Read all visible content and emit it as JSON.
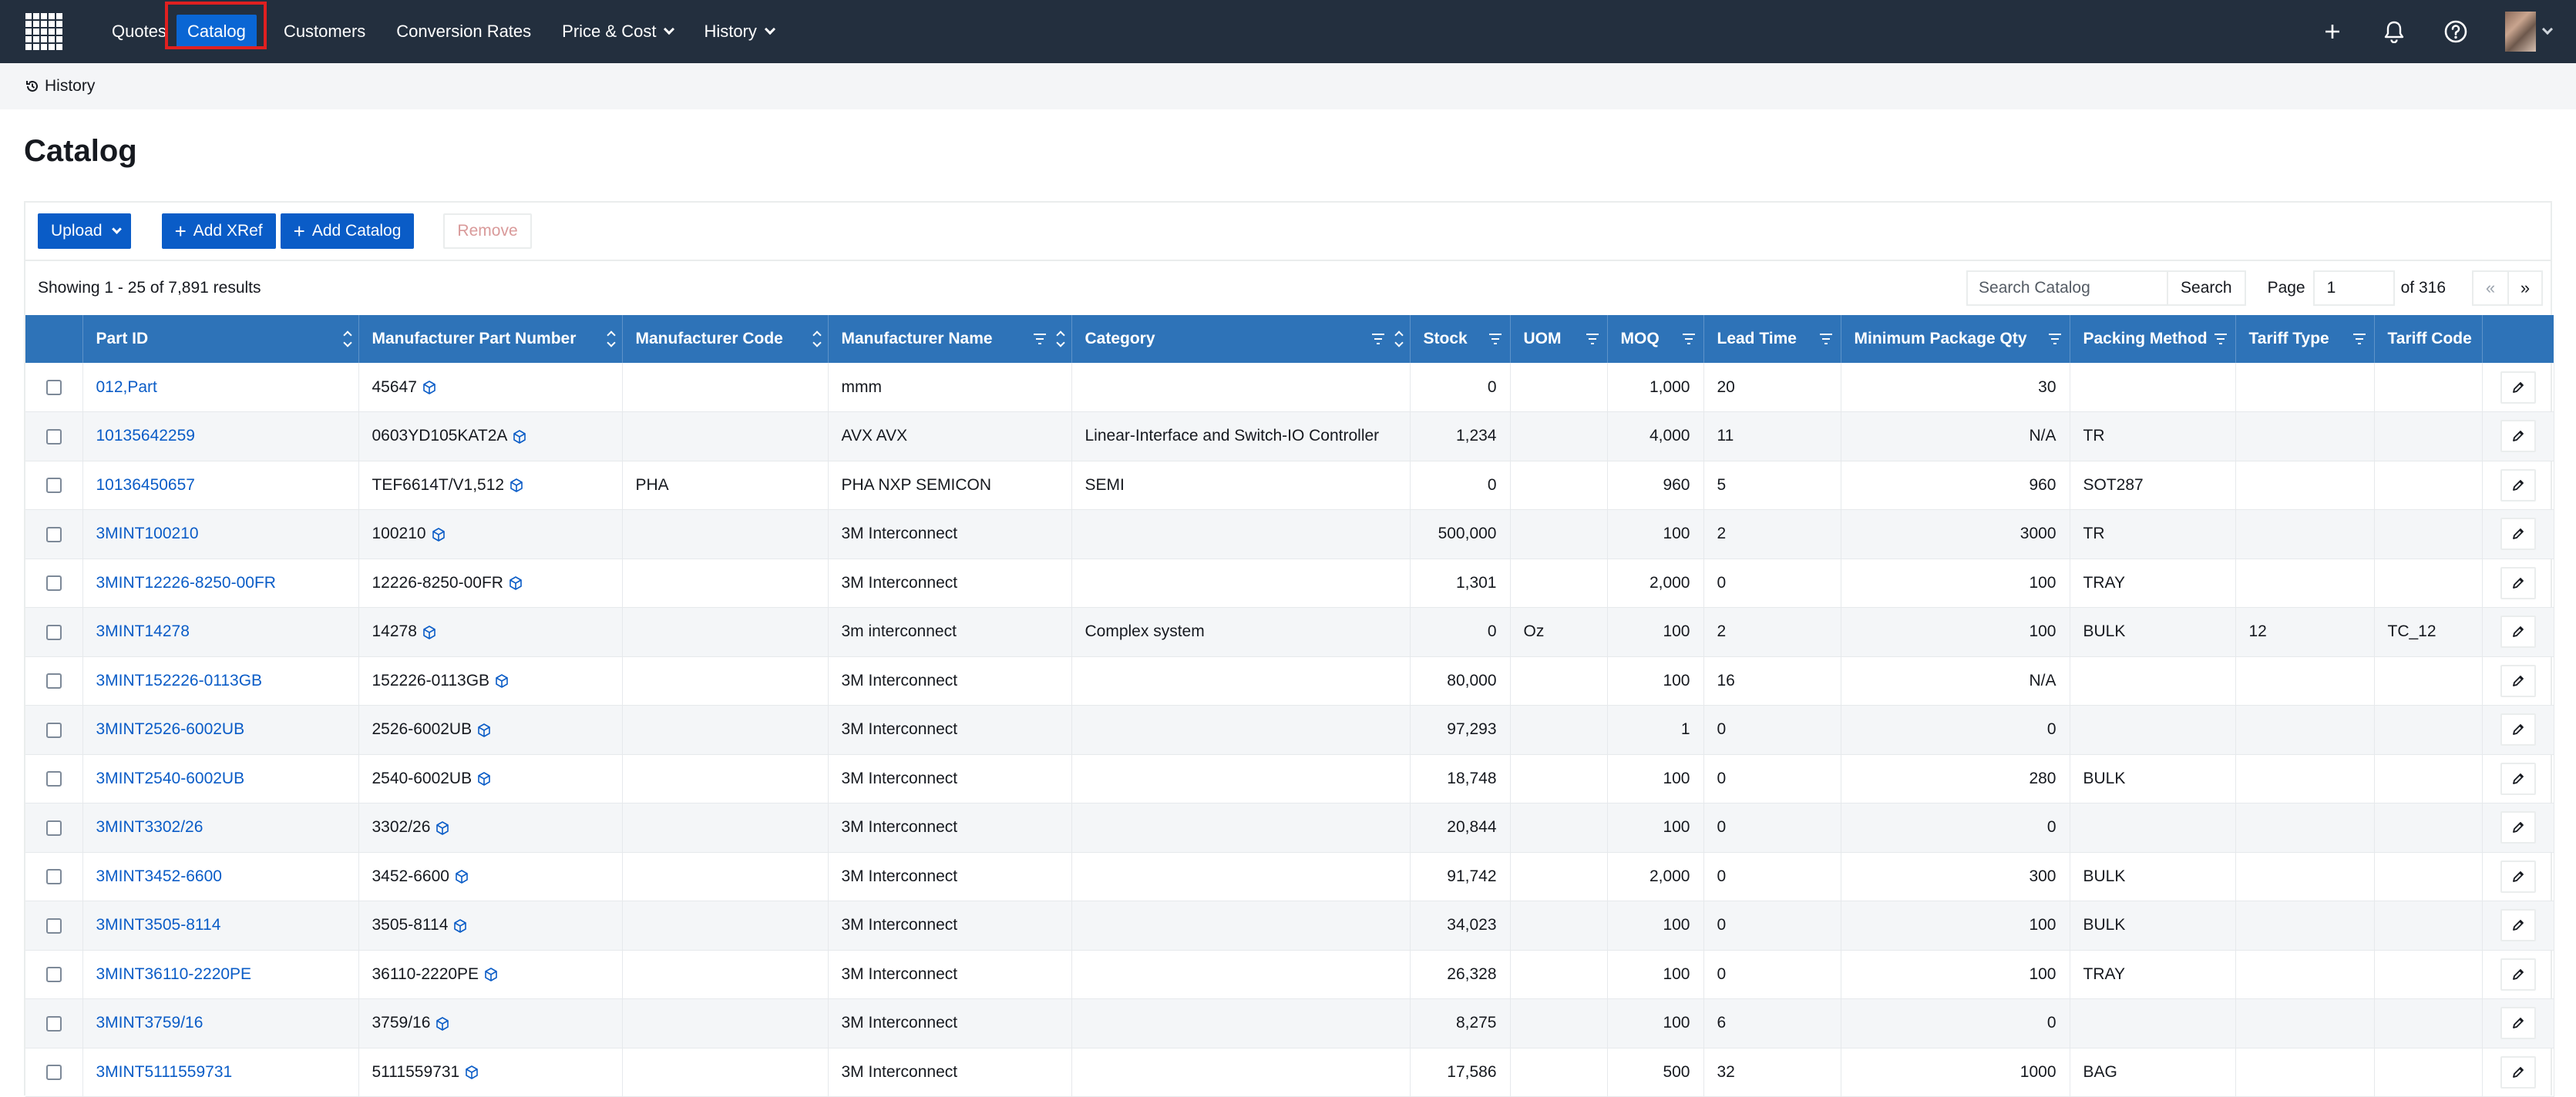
{
  "nav": {
    "items": [
      {
        "label": "Quotes"
      },
      {
        "label": "Catalog",
        "active": true
      },
      {
        "label": "Customers"
      },
      {
        "label": "Conversion Rates"
      },
      {
        "label": "Price & Cost",
        "dropdown": true
      },
      {
        "label": "History",
        "dropdown": true
      }
    ],
    "icons": [
      "plus-icon",
      "bell-icon",
      "help-icon",
      "user-avatar"
    ],
    "active_color": "#0a66d4",
    "highlight_color": "#e02020"
  },
  "breadcrumb": {
    "label": "History"
  },
  "page": {
    "title": "Catalog"
  },
  "toolbar": {
    "upload_label": "Upload",
    "add_xref_label": "Add XRef",
    "add_catalog_label": "Add Catalog",
    "remove_label": "Remove"
  },
  "results": {
    "summary": "Showing 1 - 25 of 7,891 results",
    "search_placeholder": "Search Catalog",
    "search_button": "Search",
    "page_label": "Page",
    "page_value": "1",
    "of_pages": "of 316",
    "prev_label": "«",
    "next_label": "»"
  },
  "table": {
    "columns": [
      {
        "label": "Part ID"
      },
      {
        "label": "Manufacturer Part Number"
      },
      {
        "label": "Manufacturer Code"
      },
      {
        "label": "Manufacturer Name"
      },
      {
        "label": "Category"
      },
      {
        "label": "Stock"
      },
      {
        "label": "UOM"
      },
      {
        "label": "MOQ"
      },
      {
        "label": "Lead Time"
      },
      {
        "label": "Minimum Package Qty"
      },
      {
        "label": "Packing Method"
      },
      {
        "label": "Tariff Type"
      },
      {
        "label": "Tariff Code"
      }
    ],
    "rows": [
      {
        "part_id": "012,Part",
        "mpn": "45647",
        "mfr_code": "",
        "mfr_name": "mmm",
        "category": "",
        "stock": "0",
        "uom": "",
        "moq": "1,000",
        "lead_time": "20",
        "min_pkg": "30",
        "packing": "",
        "tariff_type": "",
        "tariff_code": ""
      },
      {
        "part_id": "10135642259",
        "mpn": "0603YD105KAT2A",
        "mfr_code": "",
        "mfr_name": "AVX AVX",
        "category": "Linear-Interface and Switch-IO Controller",
        "stock": "1,234",
        "uom": "",
        "moq": "4,000",
        "lead_time": "11",
        "min_pkg": "N/A",
        "packing": "TR",
        "tariff_type": "",
        "tariff_code": ""
      },
      {
        "part_id": "10136450657",
        "mpn": "TEF6614T/V1,512",
        "mfr_code": "PHA",
        "mfr_name": "PHA NXP SEMICON",
        "category": "SEMI",
        "stock": "0",
        "uom": "",
        "moq": "960",
        "lead_time": "5",
        "min_pkg": "960",
        "packing": "SOT287",
        "tariff_type": "",
        "tariff_code": ""
      },
      {
        "part_id": "3MINT100210",
        "mpn": "100210",
        "mfr_code": "",
        "mfr_name": "3M Interconnect",
        "category": "",
        "stock": "500,000",
        "uom": "",
        "moq": "100",
        "lead_time": "2",
        "min_pkg": "3000",
        "packing": "TR",
        "tariff_type": "",
        "tariff_code": ""
      },
      {
        "part_id": "3MINT12226-8250-00FR",
        "mpn": "12226-8250-00FR",
        "mfr_code": "",
        "mfr_name": "3M Interconnect",
        "category": "",
        "stock": "1,301",
        "uom": "",
        "moq": "2,000",
        "lead_time": "0",
        "min_pkg": "100",
        "packing": "TRAY",
        "tariff_type": "",
        "tariff_code": ""
      },
      {
        "part_id": "3MINT14278",
        "mpn": "14278",
        "mfr_code": "",
        "mfr_name": "3m interconnect",
        "category": "Complex system",
        "stock": "0",
        "uom": "Oz",
        "moq": "100",
        "lead_time": "2",
        "min_pkg": "100",
        "packing": "BULK",
        "tariff_type": "12",
        "tariff_code": "TC_12"
      },
      {
        "part_id": "3MINT152226-0113GB",
        "mpn": "152226-0113GB",
        "mfr_code": "",
        "mfr_name": "3M Interconnect",
        "category": "",
        "stock": "80,000",
        "uom": "",
        "moq": "100",
        "lead_time": "16",
        "min_pkg": "N/A",
        "packing": "",
        "tariff_type": "",
        "tariff_code": ""
      },
      {
        "part_id": "3MINT2526-6002UB",
        "mpn": "2526-6002UB",
        "mfr_code": "",
        "mfr_name": "3M Interconnect",
        "category": "",
        "stock": "97,293",
        "uom": "",
        "moq": "1",
        "lead_time": "0",
        "min_pkg": "0",
        "packing": "",
        "tariff_type": "",
        "tariff_code": ""
      },
      {
        "part_id": "3MINT2540-6002UB",
        "mpn": "2540-6002UB",
        "mfr_code": "",
        "mfr_name": "3M Interconnect",
        "category": "",
        "stock": "18,748",
        "uom": "",
        "moq": "100",
        "lead_time": "0",
        "min_pkg": "280",
        "packing": "BULK",
        "tariff_type": "",
        "tariff_code": ""
      },
      {
        "part_id": "3MINT3302/26",
        "mpn": "3302/26",
        "mfr_code": "",
        "mfr_name": "3M Interconnect",
        "category": "",
        "stock": "20,844",
        "uom": "",
        "moq": "100",
        "lead_time": "0",
        "min_pkg": "0",
        "packing": "",
        "tariff_type": "",
        "tariff_code": ""
      },
      {
        "part_id": "3MINT3452-6600",
        "mpn": "3452-6600",
        "mfr_code": "",
        "mfr_name": "3M Interconnect",
        "category": "",
        "stock": "91,742",
        "uom": "",
        "moq": "2,000",
        "lead_time": "0",
        "min_pkg": "300",
        "packing": "BULK",
        "tariff_type": "",
        "tariff_code": ""
      },
      {
        "part_id": "3MINT3505-8114",
        "mpn": "3505-8114",
        "mfr_code": "",
        "mfr_name": "3M Interconnect",
        "category": "",
        "stock": "34,023",
        "uom": "",
        "moq": "100",
        "lead_time": "0",
        "min_pkg": "100",
        "packing": "BULK",
        "tariff_type": "",
        "tariff_code": ""
      },
      {
        "part_id": "3MINT36110-2220PE",
        "mpn": "36110-2220PE",
        "mfr_code": "",
        "mfr_name": "3M Interconnect",
        "category": "",
        "stock": "26,328",
        "uom": "",
        "moq": "100",
        "lead_time": "0",
        "min_pkg": "100",
        "packing": "TRAY",
        "tariff_type": "",
        "tariff_code": ""
      },
      {
        "part_id": "3MINT3759/16",
        "mpn": "3759/16",
        "mfr_code": "",
        "mfr_name": "3M Interconnect",
        "category": "",
        "stock": "8,275",
        "uom": "",
        "moq": "100",
        "lead_time": "6",
        "min_pkg": "0",
        "packing": "",
        "tariff_type": "",
        "tariff_code": ""
      },
      {
        "part_id": "3MINT5111559731",
        "mpn": "5111559731",
        "mfr_code": "",
        "mfr_name": "3M Interconnect",
        "category": "",
        "stock": "17,586",
        "uom": "",
        "moq": "500",
        "lead_time": "32",
        "min_pkg": "1000",
        "packing": "BAG",
        "tariff_type": "",
        "tariff_code": ""
      }
    ]
  }
}
